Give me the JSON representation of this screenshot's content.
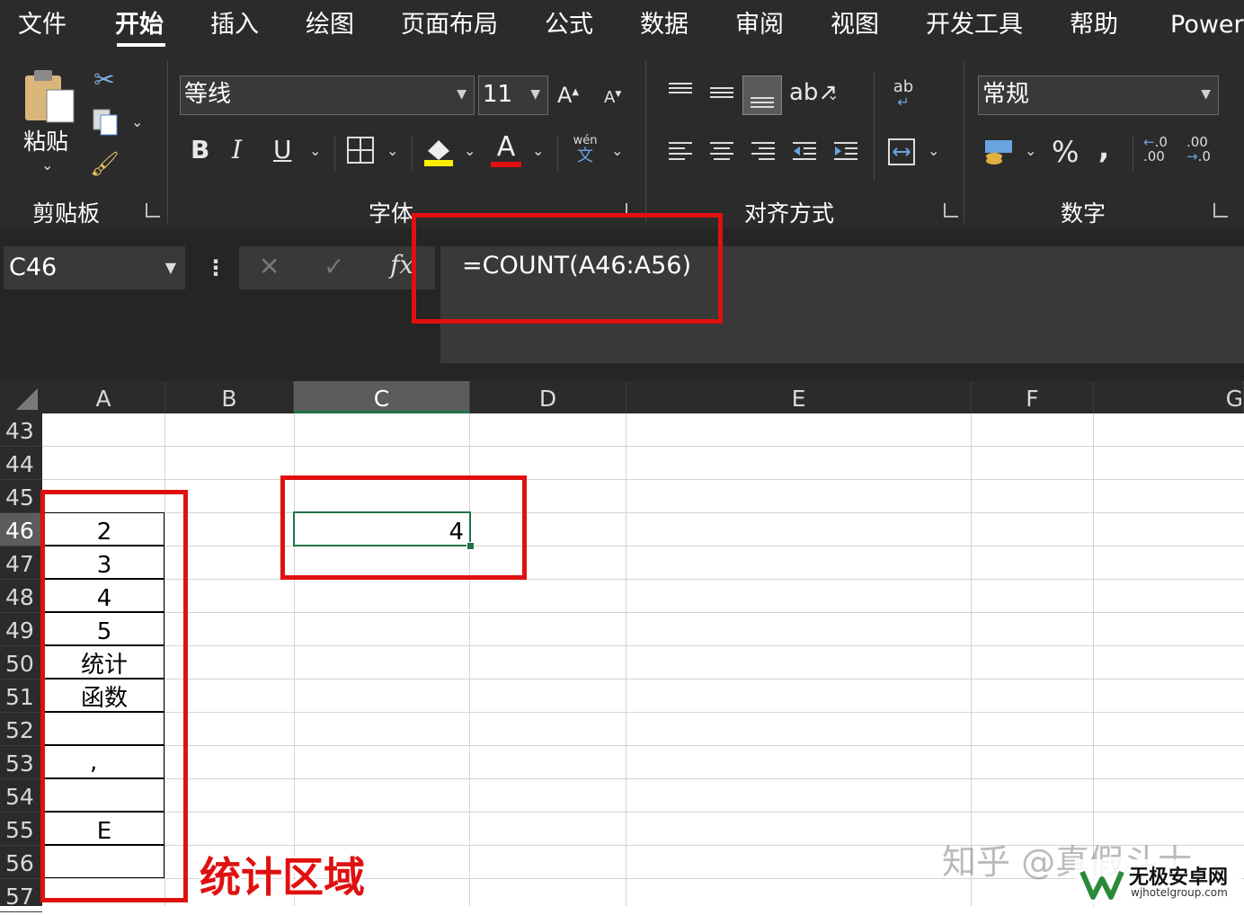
{
  "ribbon": {
    "tabs": [
      "文件",
      "开始",
      "插入",
      "绘图",
      "页面布局",
      "公式",
      "数据",
      "审阅",
      "视图",
      "开发工具",
      "帮助",
      "Power"
    ],
    "paste_label": "粘贴",
    "font_name": "等线",
    "font_size": "11",
    "wen_label": "wén",
    "wen_char": "文",
    "ab_label": "ab",
    "number_format": "常规",
    "groups": {
      "clipboard": "剪贴板",
      "font": "字体",
      "alignment": "对齐方式",
      "number": "数字"
    }
  },
  "formula_bar": {
    "name_box": "C46",
    "fx_label": "fx",
    "formula": "=COUNT(A46:A56)"
  },
  "grid": {
    "columns": [
      "A",
      "B",
      "C",
      "D",
      "E",
      "F",
      "G"
    ],
    "selected_column": "C",
    "rows": [
      "43",
      "44",
      "45",
      "46",
      "47",
      "48",
      "49",
      "50",
      "51",
      "52",
      "53",
      "54",
      "55",
      "56",
      "57"
    ],
    "a_values": [
      "2",
      "3",
      "4",
      "5",
      "统计",
      "函数",
      "",
      ",",
      "",
      "E",
      ""
    ],
    "result_value": "4"
  },
  "annotation": {
    "label": "统计区域",
    "watermark": "知乎 @真假斗士",
    "site_name": "无极安卓网",
    "site_url": "wjhotelgroup.com"
  },
  "colors": {
    "ribbon_bg": "#2b2b2b",
    "highlight_red": "#e01010",
    "excel_green": "#217346"
  }
}
